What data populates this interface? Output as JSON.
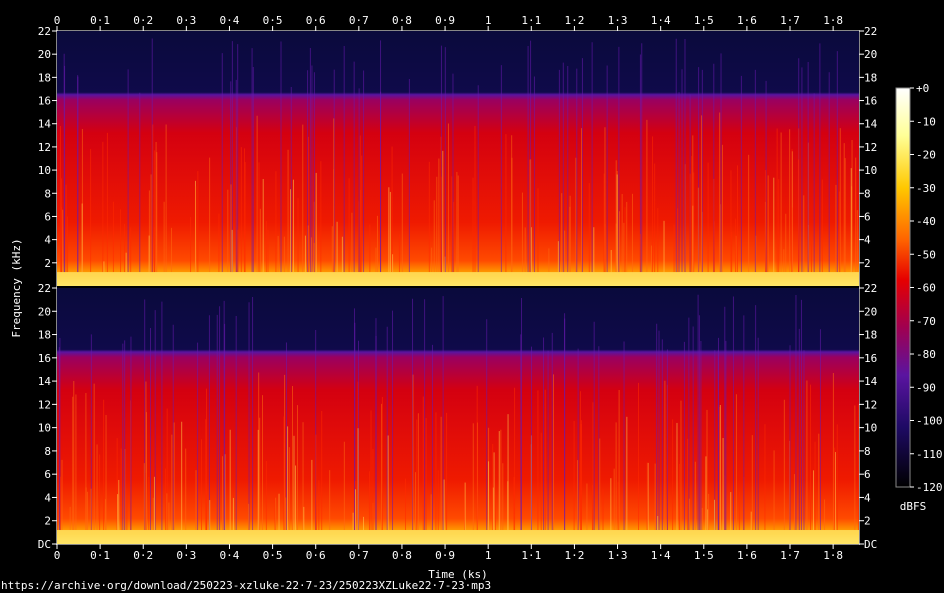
{
  "chart_data": {
    "type": "heatmap",
    "kind": "spectrogram",
    "channels": 2,
    "x_axis": {
      "label": "Time (ks)",
      "range": [
        0,
        1.86
      ],
      "ticks": [
        "0",
        "0·1",
        "0·2",
        "0·3",
        "0·4",
        "0·5",
        "0·6",
        "0·7",
        "0·8",
        "0·9",
        "1",
        "1·1",
        "1·2",
        "1·3",
        "1·4",
        "1·5",
        "1·6",
        "1·7",
        "1·8"
      ]
    },
    "y_axis": {
      "label": "Frequency (kHz)",
      "range": [
        0,
        22
      ],
      "top_channel_ticks": [
        "2",
        "4",
        "6",
        "8",
        "10",
        "12",
        "14",
        "16",
        "18",
        "20",
        "22"
      ],
      "bottom_channel_ticks": [
        "DC",
        "2",
        "4",
        "6",
        "8",
        "10",
        "12",
        "14",
        "16",
        "18",
        "20",
        "22"
      ]
    },
    "colorbar": {
      "label": "dBFS",
      "range": [
        -120,
        0
      ],
      "ticks": [
        "+0",
        "-10",
        "-20",
        "-30",
        "-40",
        "-50",
        "-60",
        "-70",
        "-80",
        "-90",
        "-100",
        "-110",
        "-120"
      ]
    },
    "spectral_cutoff_khz": 16.5,
    "energy_profile_dbfs": [
      {
        "band_khz": [
          0,
          1
        ],
        "level": -15
      },
      {
        "band_khz": [
          1,
          4
        ],
        "level": -40
      },
      {
        "band_khz": [
          4,
          12
        ],
        "level": -45
      },
      {
        "band_khz": [
          12,
          16.5
        ],
        "level": -60
      },
      {
        "band_khz": [
          16.5,
          22
        ],
        "level": -110
      }
    ],
    "colors": {
      "background": "#000000",
      "low": "#0a0a3c",
      "mid_low": "#5a14a0",
      "mid": "#e60000",
      "mid_high": "#ff8c00",
      "high": "#ffff96",
      "max": "#ffffff"
    }
  },
  "footer": {
    "source_url": "https://archive·org/download/250223-xzluke-22·7-23/250223XZLuke22·7-23·mp3"
  }
}
